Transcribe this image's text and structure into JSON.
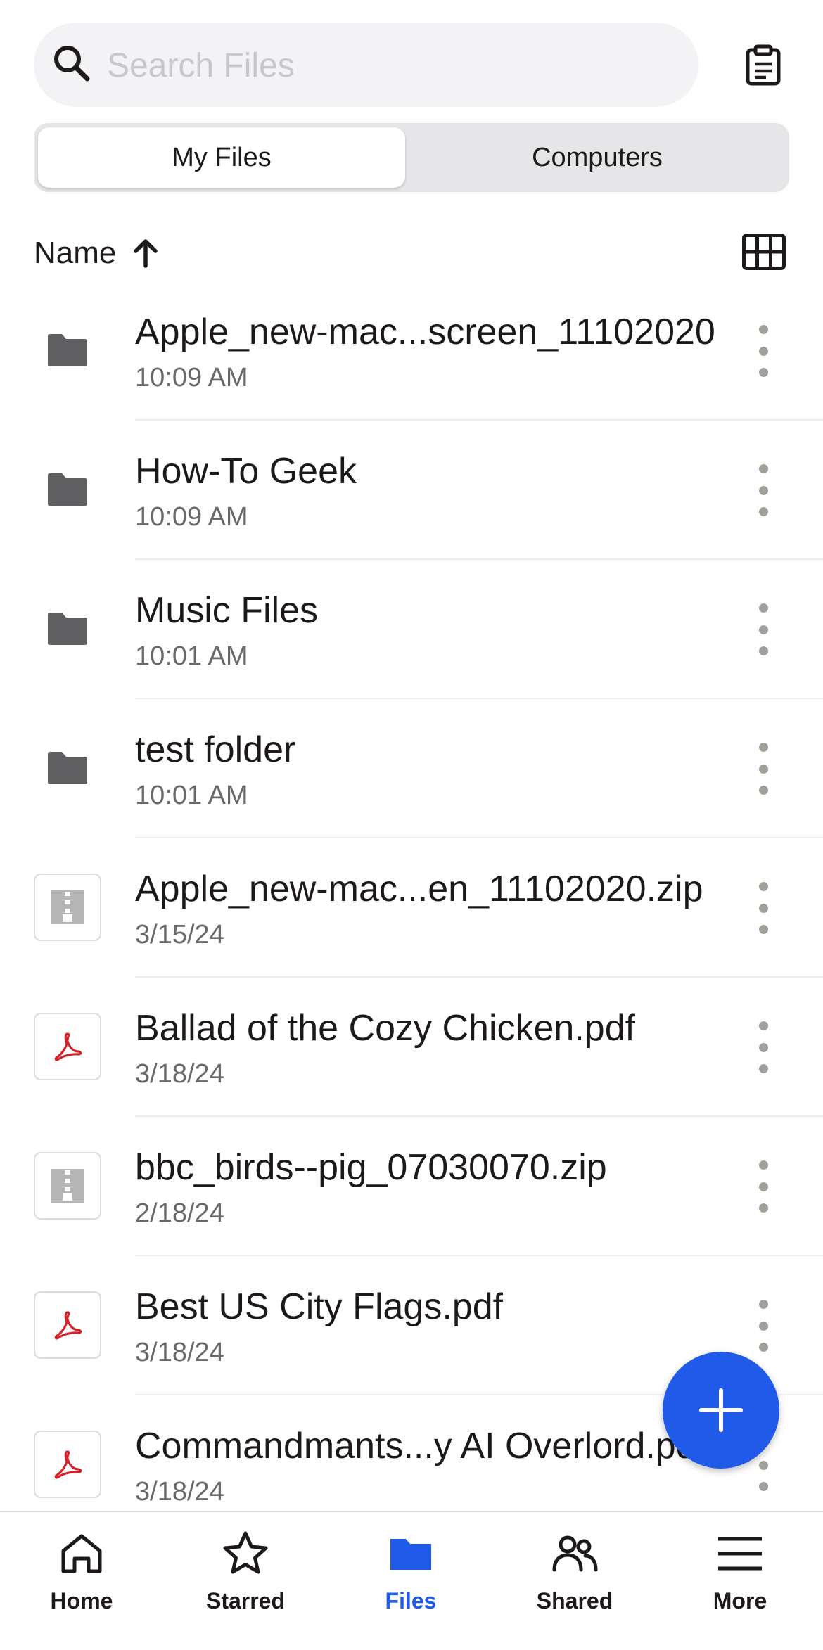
{
  "search": {
    "placeholder": "Search Files"
  },
  "tabs": [
    {
      "label": "My Files",
      "active": true
    },
    {
      "label": "Computers",
      "active": false
    }
  ],
  "sort": {
    "label": "Name",
    "direction": "ascending"
  },
  "files": [
    {
      "name": "Apple_new-mac...screen_11102020",
      "date": "10:09 AM",
      "type": "folder"
    },
    {
      "name": "How-To Geek",
      "date": "10:09 AM",
      "type": "folder"
    },
    {
      "name": "Music Files",
      "date": "10:01 AM",
      "type": "folder"
    },
    {
      "name": "test folder",
      "date": "10:01 AM",
      "type": "folder"
    },
    {
      "name": "Apple_new-mac...en_11102020.zip",
      "date": "3/15/24",
      "type": "zip"
    },
    {
      "name": "Ballad of the Cozy Chicken.pdf",
      "date": "3/18/24",
      "type": "pdf"
    },
    {
      "name": "bbc_birds--pig_07030070.zip",
      "date": "2/18/24",
      "type": "zip"
    },
    {
      "name": "Best US City Flags.pdf",
      "date": "3/18/24",
      "type": "pdf"
    },
    {
      "name": "Commandmants...y AI Overlord.pdf",
      "date": "3/18/24",
      "type": "pdf"
    }
  ],
  "nav": [
    {
      "label": "Home",
      "icon": "home-icon",
      "active": false
    },
    {
      "label": "Starred",
      "icon": "star-icon",
      "active": false
    },
    {
      "label": "Files",
      "icon": "folder-icon",
      "active": true
    },
    {
      "label": "Shared",
      "icon": "people-icon",
      "active": false
    },
    {
      "label": "More",
      "icon": "menu-icon",
      "active": false
    }
  ],
  "colors": {
    "accent": "#1f5ae9",
    "folder": "#5f5f61",
    "pdf": "#d4222a",
    "zip": "#b6b6b6"
  }
}
